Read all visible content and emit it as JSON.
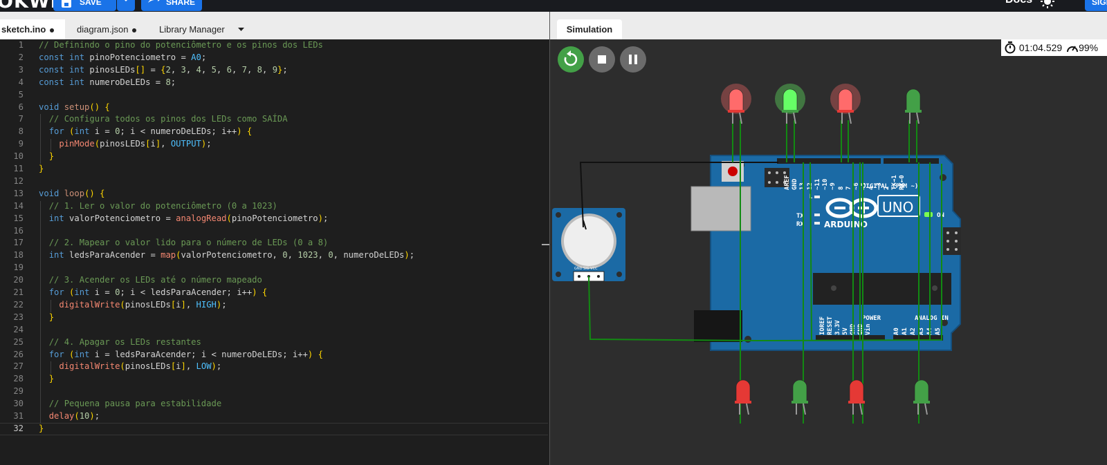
{
  "topbar": {
    "logo": "OKWI",
    "save_label": "SAVE",
    "share_label": "SHARE",
    "docs_label": "Docs",
    "signup_label": "SIGN UP"
  },
  "editor_tabs": [
    {
      "label": "sketch.ino",
      "unsaved": true
    },
    {
      "label": "diagram.json",
      "unsaved": true
    },
    {
      "label": "Library Manager"
    }
  ],
  "simulation": {
    "tab_label": "Simulation",
    "timer": "01:04.529",
    "speed": "99%",
    "board": {
      "name": "UNO",
      "brand": "ARDUINO",
      "header_labels": [
        "AREF",
        "GND",
        "13",
        "12",
        "~11",
        "~10",
        "~9",
        "8",
        "7",
        "~6",
        "~5",
        "4",
        "~3",
        "2",
        "TX→1",
        "RX←0"
      ],
      "digital_label": "DIGITAL (PWM ~)",
      "power_label": "POWER",
      "analog_label": "ANALOG IN",
      "power_pins": [
        "IOREF",
        "RESET",
        "3.3V",
        "5V",
        "GND",
        "GND",
        "Vin"
      ],
      "analog_pins": [
        "A0",
        "A1",
        "A2",
        "A3",
        "A4",
        "A5"
      ],
      "led_labels": [
        "L",
        "TX",
        "RX"
      ],
      "on_label": "ON"
    },
    "pot_pins": "GND SIG VCC",
    "leds_top": [
      {
        "color": "red",
        "lit": true
      },
      {
        "color": "green",
        "lit": true
      },
      {
        "color": "red",
        "lit": true
      },
      {
        "color": "green",
        "lit": false
      }
    ],
    "leds_bottom": [
      {
        "color": "red",
        "lit": false
      },
      {
        "color": "green",
        "lit": false
      },
      {
        "color": "red",
        "lit": false
      },
      {
        "color": "green",
        "lit": false
      }
    ]
  },
  "code": {
    "current_line": 32,
    "lines": [
      "// Definindo o pino do potenciômetro e os pinos dos LEDs",
      "const int pinoPotenciometro = A0;",
      "const int pinosLEDs[] = {2, 3, 4, 5, 6, 7, 8, 9};",
      "const int numeroDeLEDs = 8;",
      "",
      "void setup() {",
      "  // Configura todos os pinos dos LEDs como SAÍDA",
      "  for (int i = 0; i < numeroDeLEDs; i++) {",
      "    pinMode(pinosLEDs[i], OUTPUT);",
      "  }",
      "}",
      "",
      "void loop() {",
      "  // 1. Ler o valor do potenciômetro (0 a 1023)",
      "  int valorPotenciometro = analogRead(pinoPotenciometro);",
      "",
      "  // 2. Mapear o valor lido para o número de LEDs (0 a 8)",
      "  int ledsParaAcender = map(valorPotenciometro, 0, 1023, 0, numeroDeLEDs);",
      "",
      "  // 3. Acender os LEDs até o número mapeado",
      "  for (int i = 0; i < ledsParaAcender; i++) {",
      "    digitalWrite(pinosLEDs[i], HIGH);",
      "  }",
      "",
      "  // 4. Apagar os LEDs restantes",
      "  for (int i = ledsParaAcender; i < numeroDeLEDs; i++) {",
      "    digitalWrite(pinosLEDs[i], LOW);",
      "  }",
      "",
      "  // Pequena pausa para estabilidade",
      "  delay(10);",
      "}"
    ]
  }
}
